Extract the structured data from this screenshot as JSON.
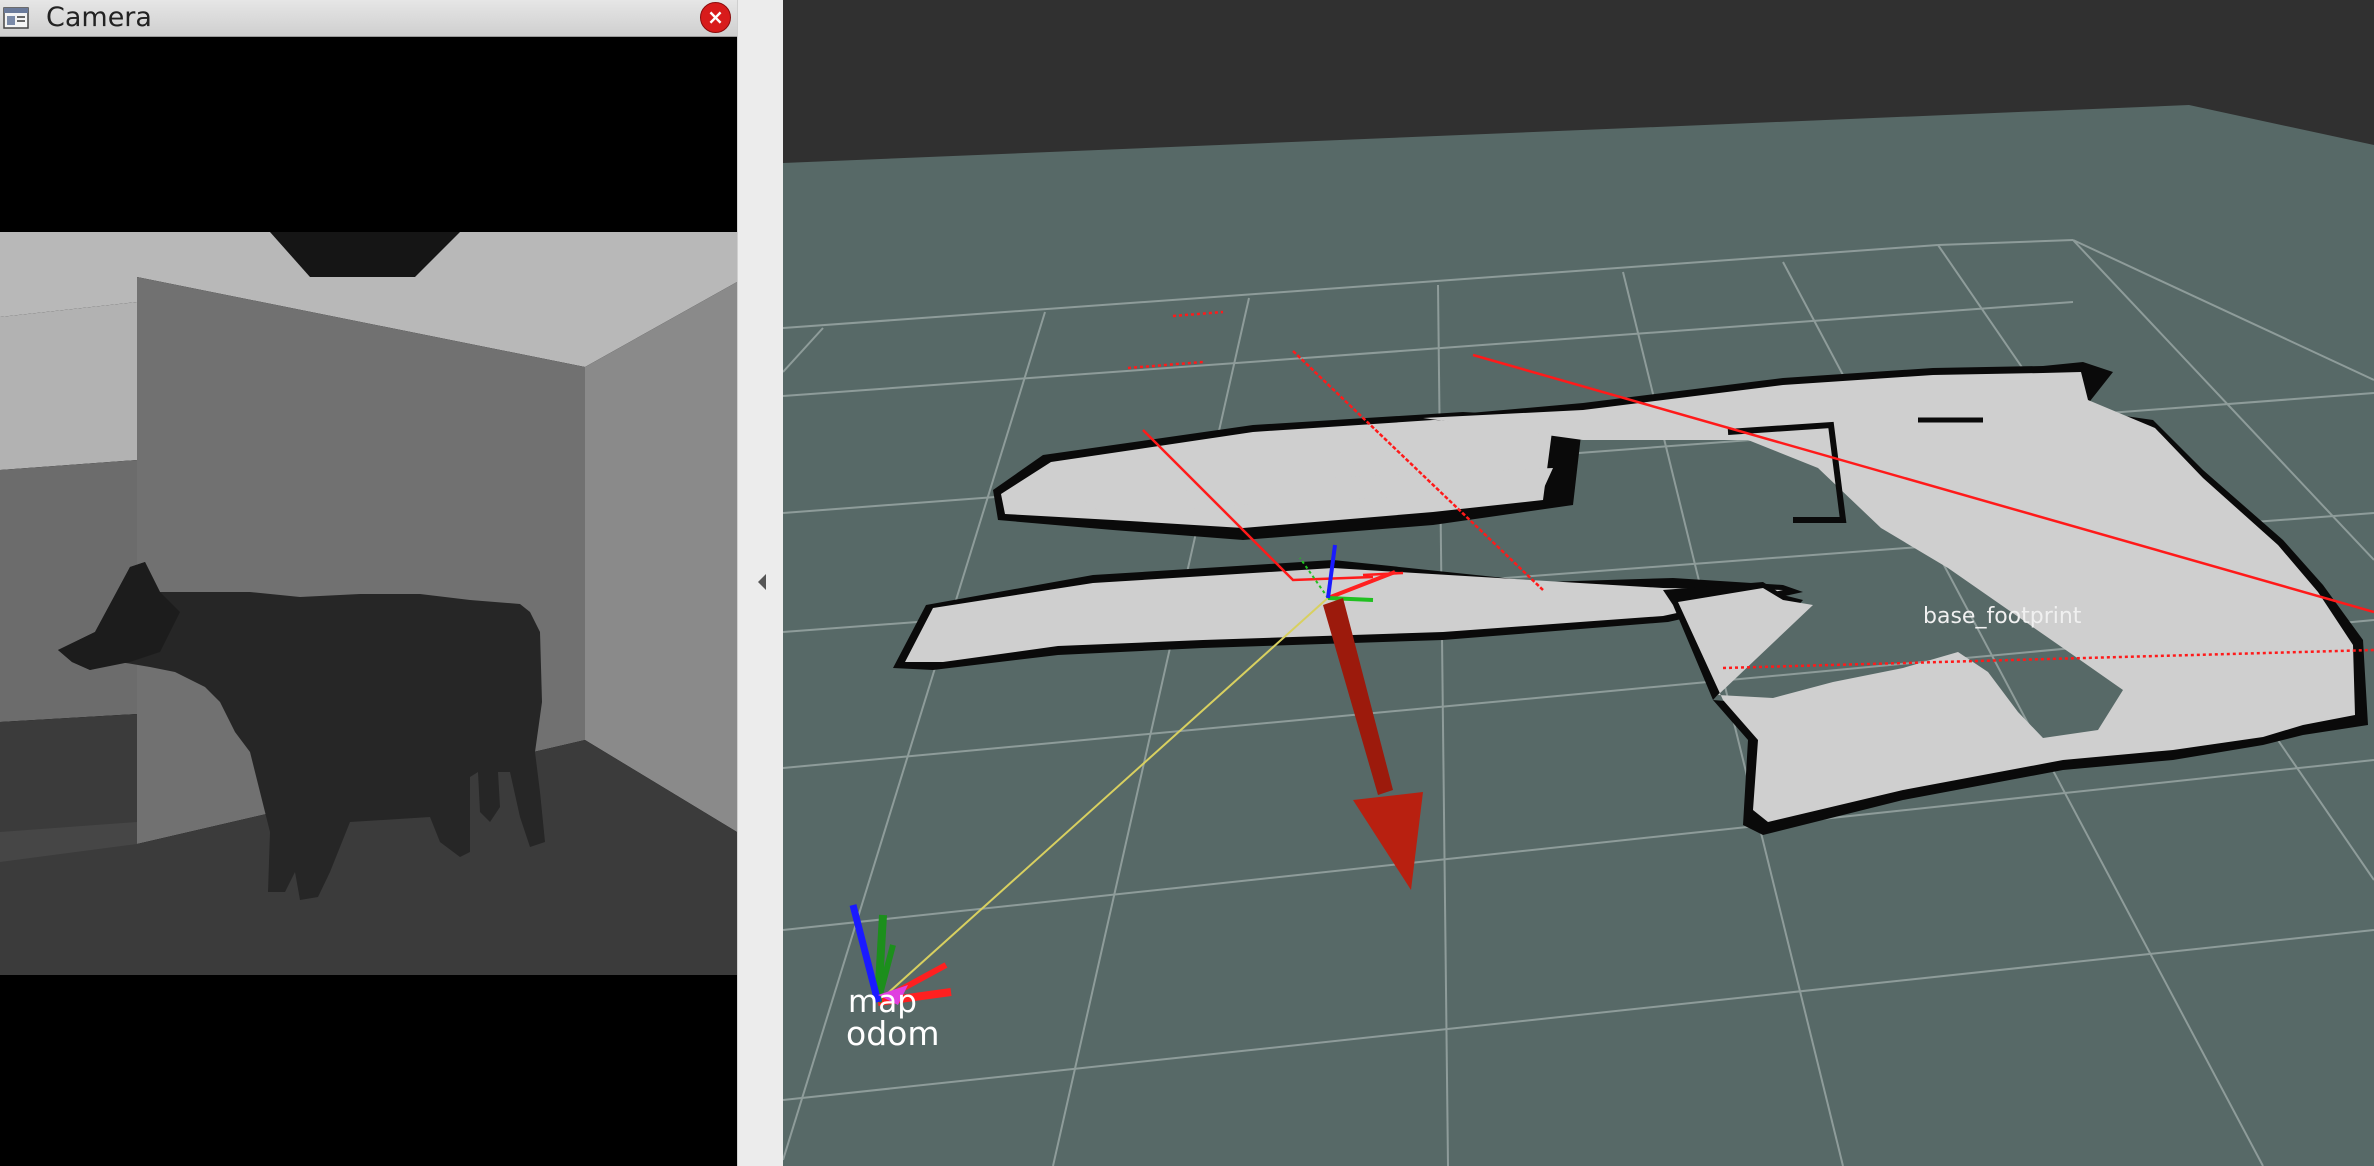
{
  "camera_panel": {
    "title": "Camera",
    "icons": {
      "window": "window-icon",
      "close": "close-icon"
    }
  },
  "splitter": {
    "icon": "collapse-left-arrow-icon"
  },
  "viewport": {
    "frames": {
      "base": "base_footprint",
      "map": "map",
      "odom": "odom"
    },
    "colors": {
      "background": "#303030",
      "ground": "#566966",
      "grid": "#9aa6a4",
      "free_space": "#cfcfcf",
      "occupied": "#0a0a0a",
      "laser": "#ff1a1a",
      "tf_link": "#d8d060",
      "x_axis": "#ff2020",
      "y_axis": "#20c020",
      "z_axis": "#1a1aff",
      "pose_arrow": "#b01a0a"
    }
  }
}
